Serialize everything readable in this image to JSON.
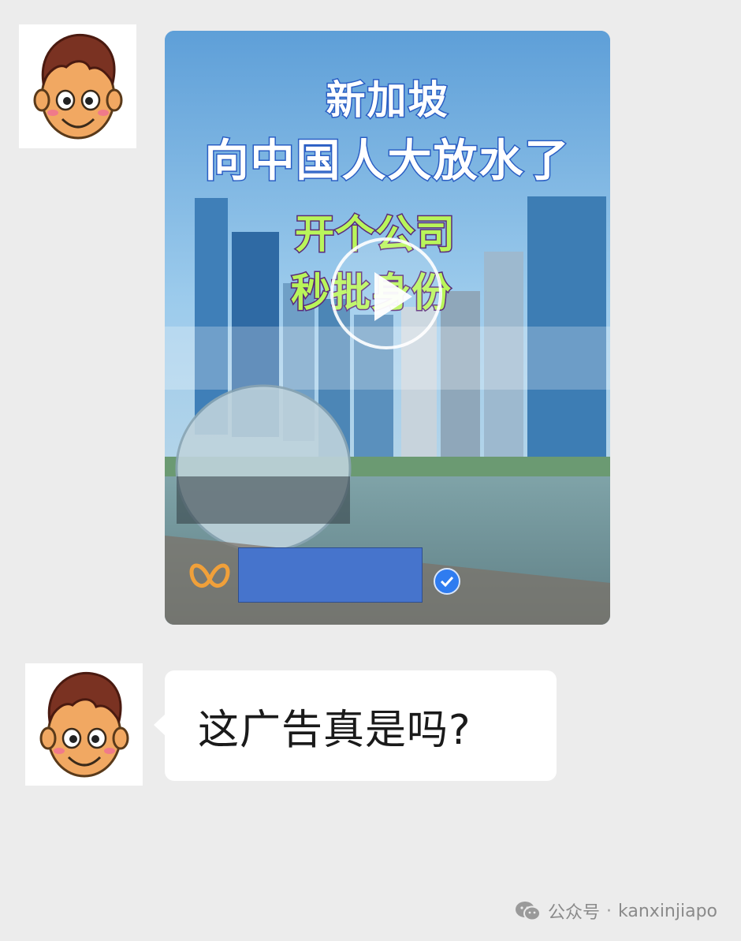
{
  "video": {
    "title_line_1": "新加坡",
    "title_line_2": "向中国人大放水了",
    "sub_line_1": "开个公司",
    "sub_line_2": "秒批身份"
  },
  "message": {
    "text": "这广告真是吗?"
  },
  "watermark": {
    "source": "公众号",
    "separator": "·",
    "account": "kanxinjiapo"
  },
  "icons": {
    "avatar": "cartoon-boy-avatar-icon",
    "play": "play-icon",
    "brand": "butterfly-logo-icon",
    "verified": "verified-check-icon",
    "wechat": "wechat-icon"
  },
  "colors": {
    "page_bg": "#ececec",
    "bubble_bg": "#ffffff",
    "redaction": "#4674cc",
    "verified": "#2f7cf0",
    "title_stroke": "#2a5ec4",
    "subtitle_fill": "#b9f55a"
  }
}
